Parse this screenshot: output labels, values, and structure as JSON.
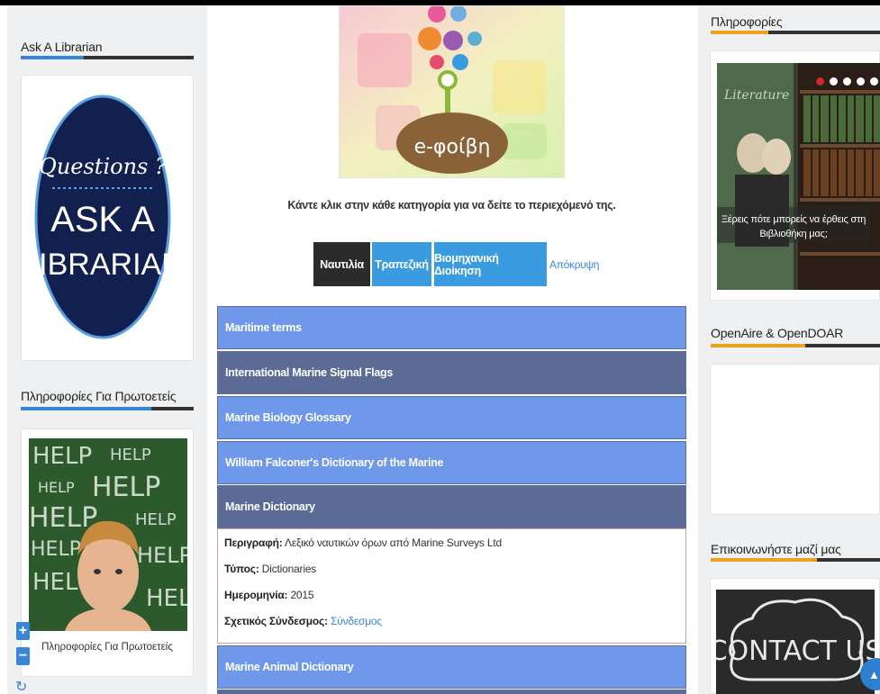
{
  "left": {
    "ask_title": "Ask A Librarian",
    "ask_graphic": {
      "line1": "Questions ?",
      "line2": "ASK A",
      "line3": "LIBRARIAN"
    },
    "firstyear_title": "Πληροφορίες Για Πρωτοετείς",
    "firstyear_caption": "Πληροφορίες Για Πρωτοετείς",
    "help_word": "HELP"
  },
  "center": {
    "logo_text": "e-φοίβη",
    "intro": "Κάντε κλικ στην κάθε κατηγορία για να δείτε το περιεχόμενό της.",
    "tabs": [
      {
        "label": "Ναυτιλία",
        "state": "active"
      },
      {
        "label": "Τραπεζική",
        "state": "normal"
      },
      {
        "label": "Βιομηχανική Διοίκηση",
        "state": "normal"
      }
    ],
    "hide_link": "Απόκρυψη",
    "accordion": [
      {
        "title": "Maritime terms",
        "style": "light"
      },
      {
        "title": "International Marine Signal Flags",
        "style": "dark"
      },
      {
        "title": "Marine Biology Glossary",
        "style": "light"
      },
      {
        "title": "William Falconer's Dictionary of the Marine",
        "style": "light"
      },
      {
        "title": "Marine Dictionary",
        "style": "dark"
      },
      {
        "title": "Marine Animal Dictionary",
        "style": "light"
      }
    ],
    "expanded": {
      "description_label": "Περιγραφή:",
      "description_value": "Λεξικό ναυτικών όρων από Marine Surveys Ltd",
      "type_label": "Τύπος:",
      "type_value": "Dictionaries",
      "date_label": "Ημερομηνία:",
      "date_value": "2015",
      "link_label": "Σχετικός Σύνδεσμος:",
      "link_value": "Σύνδεσμος"
    }
  },
  "right": {
    "info_title": "Πληροφορίες",
    "slide_caption": "Ξέρεις πότε μπορείς να έρθεις στη Βιβλιοθήκη μας;",
    "slide_book_text": "Literature",
    "openaire_title": "OpenAire & OpenDOAR",
    "contact_title": "Επικοινωνήστε μαζί μας",
    "contact_graphic": "CONTACT US"
  },
  "colors": {
    "accent_blue": "#3a86d6",
    "accent_orange": "#f0a020",
    "tab_active": "#2b2b2b",
    "tab_normal": "#3a9be0",
    "accordion_light": "#6f98ea",
    "accordion_dark": "#5c6a96"
  },
  "controls": {
    "zoom_in": "+",
    "zoom_out": "−",
    "reset": "↻",
    "scroll_top": "▲"
  }
}
